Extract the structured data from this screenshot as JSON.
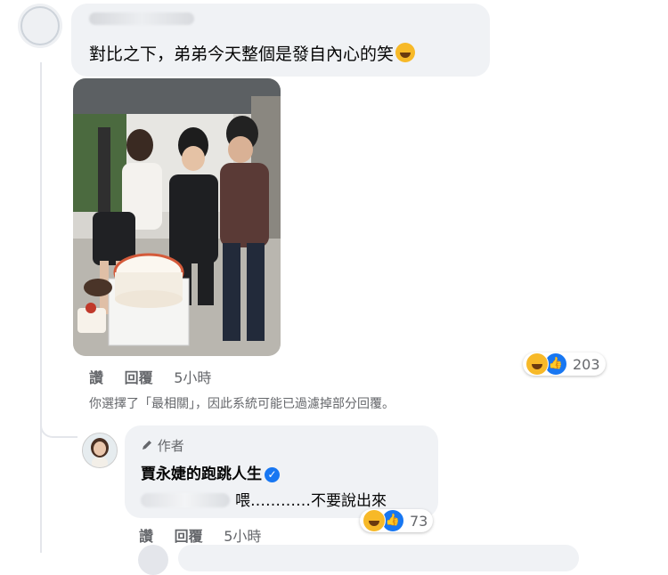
{
  "comment": {
    "text": "對比之下，弟弟今天整個是發自內心的笑",
    "emoji": "rolling-on-floor-laughing-emoji",
    "actions": {
      "like": "讚",
      "reply": "回覆",
      "time": "5小時"
    },
    "reaction_count": "203"
  },
  "filter_notice": "你選擇了「最相關」，因此系統可能已過濾掉部分回覆。",
  "reply": {
    "badge": "作者",
    "author": "賈永婕的跑跳人生",
    "text": "喂…………不要說出來",
    "actions": {
      "like": "讚",
      "reply": "回覆",
      "time": "5小時"
    },
    "reaction_count": "73"
  },
  "colors": {
    "accent": "#1877f2",
    "bubble": "#f0f2f5",
    "haha": "#f7b928"
  }
}
